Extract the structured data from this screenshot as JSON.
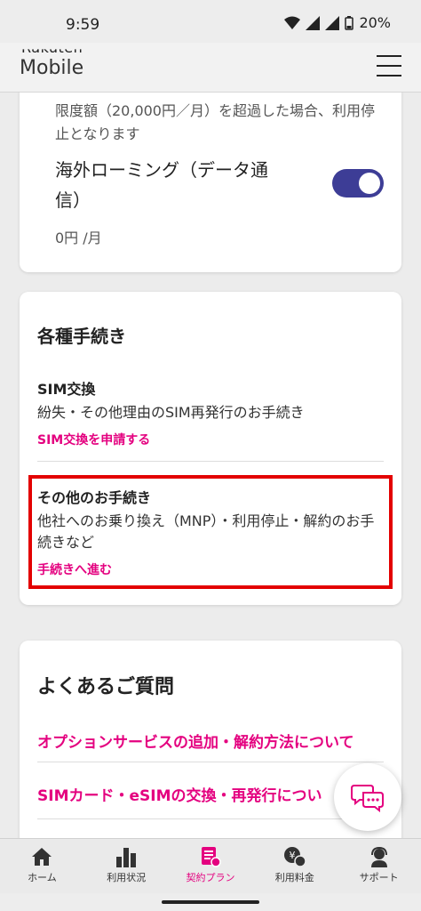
{
  "status": {
    "time": "9:59",
    "battery": "20%"
  },
  "header": {
    "logo_top": "Rakuten",
    "logo_bottom": "Mobile"
  },
  "roaming_card": {
    "note": "限度額（20,000円／月）を超過した場合、利用停止となります",
    "label": "海外ローミング（データ通信）",
    "toggle_on": true,
    "price": "0円 /月"
  },
  "procedures": {
    "title": "各種手続き",
    "sim_swap": {
      "title": "SIM交換",
      "desc": "紛失・その他理由のSIM再発行のお手続き",
      "link": "SIM交換を申請する"
    },
    "other": {
      "title": "その他のお手続き",
      "desc": "他社へのお乗り換え（MNP）・利用停止・解約のお手続きなど",
      "link": "手続きへ進む"
    }
  },
  "faq": {
    "title": "よくあるご質問",
    "items": [
      "オプションサービスの追加・解約方法について",
      "SIMカード・eSIMの交換・再発行につい"
    ]
  },
  "bottom_nav": {
    "items": [
      {
        "label": "ホーム",
        "icon": "home-icon"
      },
      {
        "label": "利用状況",
        "icon": "bar-chart-icon"
      },
      {
        "label": "契約プラン",
        "icon": "plan-icon"
      },
      {
        "label": "利用料金",
        "icon": "yen-icon"
      },
      {
        "label": "サポート",
        "icon": "support-icon"
      }
    ],
    "active_index": 2
  },
  "colors": {
    "accent": "#e4007f",
    "toggle": "#3d3d96",
    "highlight": "#e30000"
  }
}
